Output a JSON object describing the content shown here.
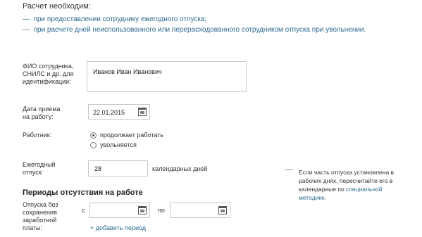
{
  "intro": {
    "title": "Расчет необходим:",
    "dash": "—",
    "items": [
      "при предоставлении сотруднику ежегодного отпуска;",
      "при расчете дней неиспользованного или перерасходованного сотрудником отпуска при увольнении."
    ]
  },
  "form": {
    "employee": {
      "label": [
        "ФИО сотрудника,",
        "СНИЛС и др. для",
        "идентификации:"
      ],
      "value": "Иванов Иван Иванович"
    },
    "hire_date": {
      "label": [
        "Дата приема",
        "на работу:"
      ],
      "value": "22.01.2015",
      "icon": "calendar-icon"
    },
    "worker": {
      "label": "Работник:",
      "options": [
        {
          "label": "продолжает работать",
          "selected": true
        },
        {
          "label": "увольняется",
          "selected": false
        }
      ]
    },
    "annual_leave": {
      "label": [
        "Ежегодный",
        "отпуск:"
      ],
      "value": "28",
      "unit": "календарных дней"
    },
    "hint": {
      "lines": [
        "Если часть отпуска установлена в",
        "рабочих днях, пересчитайте его в",
        "календарные по "
      ],
      "link1": "специальной",
      "link2": "методике",
      "tail": "."
    }
  },
  "absence": {
    "title": "Периоды отсутствия на работе",
    "unpaid": {
      "label": [
        "Отпуска без",
        "сохранения",
        "заработной",
        "платы:"
      ],
      "from_label": "с",
      "to_label": "по",
      "from_value": "",
      "to_value": ""
    },
    "add_period": "+ добавить период"
  }
}
